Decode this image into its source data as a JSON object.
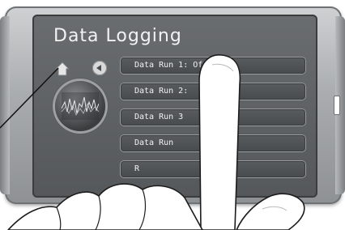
{
  "screen": {
    "title": "Data Logging"
  },
  "icons": {
    "home": "home-icon",
    "back": "back-arrow-icon",
    "gauge": "data-graph-icon"
  },
  "menu": {
    "items": [
      {
        "label": "Data Run 1: Off"
      },
      {
        "label": "Data Run 2:"
      },
      {
        "label": "Data Run 3"
      },
      {
        "label": "Data Run"
      },
      {
        "label": "R"
      }
    ]
  },
  "colors": {
    "frame": "#a9acae",
    "screen": "#5f6265",
    "menu_item": "#4f5255",
    "text": "#f2f2f2"
  }
}
